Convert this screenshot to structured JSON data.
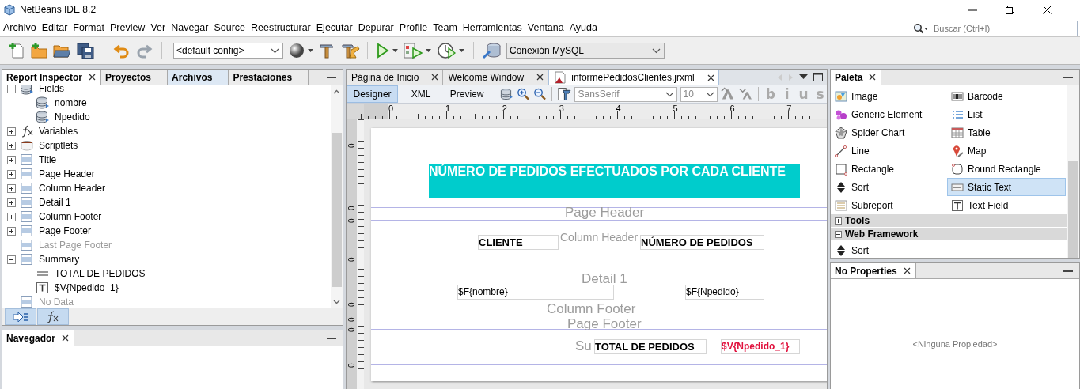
{
  "window": {
    "title": "NetBeans IDE 8.2"
  },
  "menu": [
    "Archivo",
    "Editar",
    "Format",
    "Preview",
    "Ver",
    "Navegar",
    "Source",
    "Reestructurar",
    "Ejecutar",
    "Depurar",
    "Profile",
    "Team",
    "Herramientas",
    "Ventana",
    "Ayuda"
  ],
  "search": {
    "placeholder": "Buscar (Ctrl+I)"
  },
  "toolbar": {
    "config": "<default config>",
    "connection": "Conexión MySQL"
  },
  "inspector": {
    "tabs": [
      {
        "label": "Report Inspector",
        "selected": true
      },
      {
        "label": "Proyectos",
        "selected": false
      },
      {
        "label": "Archivos",
        "selected": false
      },
      {
        "label": "Prestaciones",
        "selected": false
      }
    ],
    "tree": [
      {
        "label": "Fields",
        "kind": "fields",
        "expanded": true,
        "disabled": false,
        "children": [
          {
            "label": "nombre",
            "kind": "field",
            "disabled": false
          },
          {
            "label": "Npedido",
            "kind": "field",
            "disabled": false
          }
        ]
      },
      {
        "label": "Variables",
        "kind": "variables",
        "expanded": false,
        "disabled": false
      },
      {
        "label": "Scriptlets",
        "kind": "scriptlets",
        "expanded": false,
        "disabled": false
      },
      {
        "label": "Title",
        "kind": "band",
        "expanded": false,
        "disabled": false
      },
      {
        "label": "Page Header",
        "kind": "band",
        "expanded": false,
        "disabled": false
      },
      {
        "label": "Column Header",
        "kind": "band",
        "expanded": false,
        "disabled": false
      },
      {
        "label": "Detail 1",
        "kind": "band",
        "expanded": false,
        "disabled": false
      },
      {
        "label": "Column Footer",
        "kind": "band",
        "expanded": false,
        "disabled": false
      },
      {
        "label": "Page Footer",
        "kind": "band",
        "expanded": false,
        "disabled": false
      },
      {
        "label": "Last Page Footer",
        "kind": "band",
        "disabled": true
      },
      {
        "label": "Summary",
        "kind": "band",
        "expanded": true,
        "disabled": false,
        "children": [
          {
            "label": "TOTAL DE PEDIDOS",
            "kind": "label",
            "disabled": false
          },
          {
            "label": "$V{Npedido_1}",
            "kind": "textfield",
            "disabled": false
          }
        ]
      },
      {
        "label": "No Data",
        "kind": "band",
        "disabled": true
      }
    ]
  },
  "navigator": {
    "tabs": [
      {
        "label": "Navegador",
        "selected": true
      }
    ]
  },
  "editor": {
    "tabs": [
      {
        "label": "Página de Inicio",
        "selected": false
      },
      {
        "label": "Welcome Window",
        "selected": false
      },
      {
        "label": "informePedidosClientes.jrxml",
        "selected": true
      }
    ],
    "views": [
      {
        "label": "Designer",
        "selected": true
      },
      {
        "label": "XML",
        "selected": false
      },
      {
        "label": "Preview",
        "selected": false
      }
    ],
    "font": "SansSerif",
    "font_size": "10",
    "format_buttons": [
      "b",
      "i",
      "u",
      "s"
    ],
    "ruler": [
      "0",
      "1",
      "2",
      "3",
      "4",
      "5",
      "6",
      "7"
    ],
    "side_ruler": [
      "0",
      "0",
      "0",
      "0",
      "0",
      "0",
      "0",
      "0"
    ],
    "bands": [
      "Page Header",
      "Column Header",
      "Detail 1",
      "Column Footer",
      "Page Footer",
      "Su"
    ],
    "elements": [
      {
        "kind": "title",
        "text": "NÚMERO DE PEDIDOS EFECTUADOS POR CADA CLIENTE"
      },
      {
        "kind": "label",
        "text": "CLIENTE"
      },
      {
        "kind": "label",
        "text": "NÚMERO DE PEDIDOS"
      },
      {
        "kind": "field",
        "text": "$F{nombre}"
      },
      {
        "kind": "field",
        "text": "$F{Npedido}"
      },
      {
        "kind": "label",
        "text": "TOTAL DE PEDIDOS"
      },
      {
        "kind": "variable",
        "text": "$V{Npedido_1}"
      }
    ]
  },
  "palette": {
    "tabs": [
      {
        "label": "Paleta",
        "selected": true
      }
    ],
    "items": [
      {
        "label": "Image",
        "selected": false
      },
      {
        "label": "Barcode",
        "selected": false
      },
      {
        "label": "Generic Element",
        "selected": false
      },
      {
        "label": "List",
        "selected": false
      },
      {
        "label": "Spider Chart",
        "selected": false
      },
      {
        "label": "Table",
        "selected": false
      },
      {
        "label": "Line",
        "selected": false
      },
      {
        "label": "Map",
        "selected": false
      },
      {
        "label": "Rectangle",
        "selected": false
      },
      {
        "label": "Round Rectangle",
        "selected": false
      },
      {
        "label": "Sort",
        "selected": false
      },
      {
        "label": "Static Text",
        "selected": true
      },
      {
        "label": "Subreport",
        "selected": false
      },
      {
        "label": "Text Field",
        "selected": false
      }
    ],
    "groups": [
      {
        "label": "Tools",
        "expanded": false
      },
      {
        "label": "Web Framework",
        "expanded": true,
        "items": [
          {
            "label": "Sort",
            "selected": false
          }
        ]
      }
    ]
  },
  "properties": {
    "tabs": [
      {
        "label": "No Properties",
        "selected": true
      }
    ],
    "message": "<Ninguna Propiedad>"
  }
}
